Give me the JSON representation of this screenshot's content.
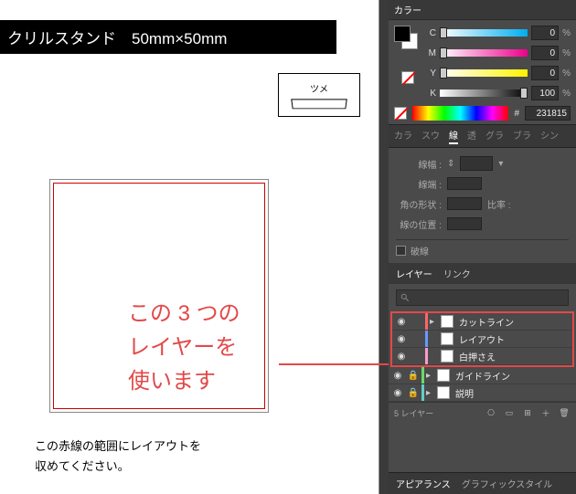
{
  "document": {
    "title_bar": "クリルスタンド　50mm×50mm",
    "tsume_label": "ツメ",
    "annotation_l1": "この 3 つの",
    "annotation_l2": "レイヤーを",
    "annotation_l3": "使います",
    "caption_l1": "この赤線の範囲にレイアウトを",
    "caption_l2": "収めてください。"
  },
  "color": {
    "c_label": "C",
    "c_value": "0",
    "m_label": "M",
    "m_value": "0",
    "y_label": "Y",
    "y_value": "0",
    "k_label": "K",
    "k_value": "100",
    "hex_marker": "#",
    "hex_value": "231815",
    "pct": "%"
  },
  "tabs": {
    "t1": "カラ",
    "t2": "スウ",
    "t3": "線",
    "t4": "透",
    "t5": "グラ",
    "t6": "ブラ",
    "t7": "シン"
  },
  "stroke": {
    "width_label": "線幅 :",
    "cap_label": "線端 :",
    "corner_label": "角の形状 :",
    "ratio_label": "比率 :",
    "align_label": "線の位置 :",
    "dash_label": "破線"
  },
  "layers": {
    "tab_layers": "レイヤー",
    "tab_links": "リンク",
    "search_placeholder": "",
    "l1": "カットライン",
    "l2": "レイアウト",
    "l3": "白押さえ",
    "l4": "ガイドライン",
    "l5": "説明",
    "footer_count": "5 レイヤー"
  },
  "appearance": {
    "tab1": "アピアランス",
    "tab2": "グラフィックスタイル"
  }
}
